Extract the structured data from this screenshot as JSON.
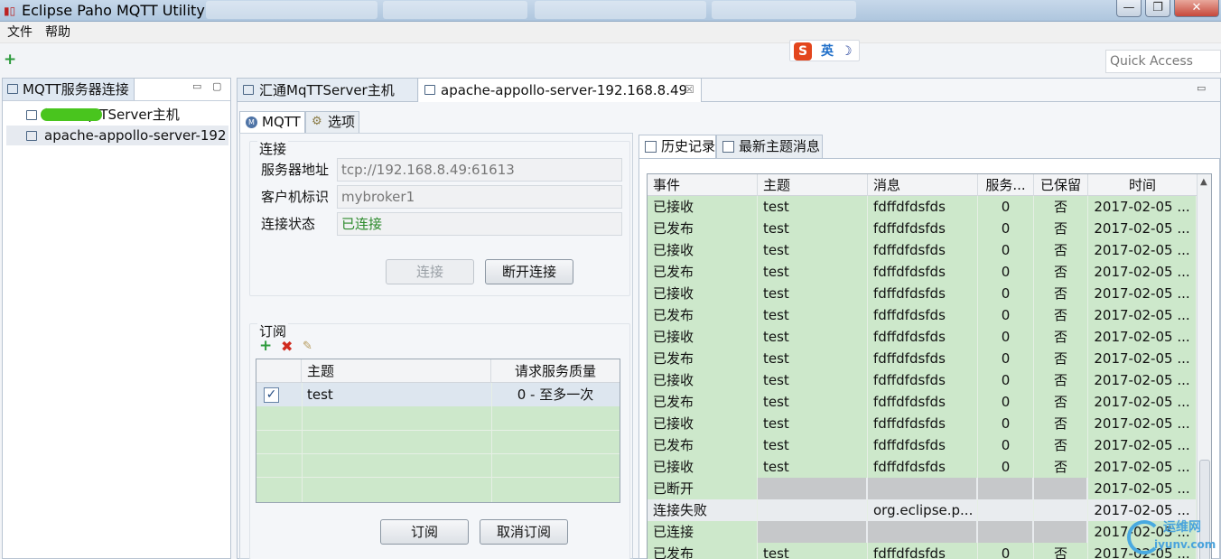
{
  "window": {
    "title": "Eclipse Paho MQTT Utility",
    "minimize": "—",
    "maximize": "❐",
    "close": "✕"
  },
  "menu": {
    "file": "文件",
    "help": "帮助"
  },
  "toolbar": {
    "add": "+",
    "quick_access_placeholder": "Quick Access"
  },
  "ime": {
    "logo": "S",
    "mode": "英",
    "moon": "☽"
  },
  "left_view": {
    "tab_label": "MQTT服务器连接",
    "minimize": "▭",
    "maximize": "▢",
    "nodes": [
      {
        "label": "汇通MqTTServer主机"
      },
      {
        "label": "apache-appollo-server-192"
      }
    ]
  },
  "editor": {
    "tabs": [
      {
        "label": "汇通MqTTServer主机"
      },
      {
        "label": "apache-appollo-server-192.168.8.49",
        "close": "☒"
      }
    ],
    "sub_tabs": {
      "mqtt": "MQTT",
      "options": "选项"
    }
  },
  "connection": {
    "title": "连接",
    "server_label": "服务器地址",
    "server_value": "tcp://192.168.8.49:61613",
    "client_label": "客户机标识",
    "client_value": "mybroker1",
    "status_label": "连接状态",
    "status_value": "已连接",
    "connect_button": "连接",
    "disconnect_button": "断开连接"
  },
  "subscription": {
    "title": "订阅",
    "add": "+",
    "delete": "✖",
    "clear": "✎",
    "columns": [
      "",
      "主题",
      "请求服务质量"
    ],
    "rows": [
      {
        "checked": "✓",
        "topic": "test",
        "qos": "0 - 至多一次"
      }
    ],
    "subscribe_button": "订阅",
    "unsubscribe_button": "取消订阅"
  },
  "history": {
    "tabs": {
      "history": "历史记录",
      "latest": "最新主题消息"
    },
    "columns": [
      "事件",
      "主题",
      "消息",
      "服务...",
      "已保留",
      "时间"
    ],
    "rows": [
      {
        "event": "已接收",
        "topic": "test",
        "message": "fdffdfdsfds",
        "qos": "0",
        "retained": "否",
        "time": "2017-02-05 ...",
        "style": "green"
      },
      {
        "event": "已发布",
        "topic": "test",
        "message": "fdffdfdsfds",
        "qos": "0",
        "retained": "否",
        "time": "2017-02-05 ...",
        "style": "green"
      },
      {
        "event": "已接收",
        "topic": "test",
        "message": "fdffdfdsfds",
        "qos": "0",
        "retained": "否",
        "time": "2017-02-05 ...",
        "style": "green"
      },
      {
        "event": "已发布",
        "topic": "test",
        "message": "fdffdfdsfds",
        "qos": "0",
        "retained": "否",
        "time": "2017-02-05 ...",
        "style": "green"
      },
      {
        "event": "已接收",
        "topic": "test",
        "message": "fdffdfdsfds",
        "qos": "0",
        "retained": "否",
        "time": "2017-02-05 ...",
        "style": "green"
      },
      {
        "event": "已发布",
        "topic": "test",
        "message": "fdffdfdsfds",
        "qos": "0",
        "retained": "否",
        "time": "2017-02-05 ...",
        "style": "green"
      },
      {
        "event": "已接收",
        "topic": "test",
        "message": "fdffdfdsfds",
        "qos": "0",
        "retained": "否",
        "time": "2017-02-05 ...",
        "style": "green"
      },
      {
        "event": "已发布",
        "topic": "test",
        "message": "fdffdfdsfds",
        "qos": "0",
        "retained": "否",
        "time": "2017-02-05 ...",
        "style": "green"
      },
      {
        "event": "已接收",
        "topic": "test",
        "message": "fdffdfdsfds",
        "qos": "0",
        "retained": "否",
        "time": "2017-02-05 ...",
        "style": "green"
      },
      {
        "event": "已发布",
        "topic": "test",
        "message": "fdffdfdsfds",
        "qos": "0",
        "retained": "否",
        "time": "2017-02-05 ...",
        "style": "green"
      },
      {
        "event": "已接收",
        "topic": "test",
        "message": "fdffdfdsfds",
        "qos": "0",
        "retained": "否",
        "time": "2017-02-05 ...",
        "style": "green"
      },
      {
        "event": "已发布",
        "topic": "test",
        "message": "fdffdfdsfds",
        "qos": "0",
        "retained": "否",
        "time": "2017-02-05 ...",
        "style": "green"
      },
      {
        "event": "已接收",
        "topic": "test",
        "message": "fdffdfdsfds",
        "qos": "0",
        "retained": "否",
        "time": "2017-02-05 ...",
        "style": "green"
      },
      {
        "event": "已断开",
        "topic": "",
        "message": "",
        "qos": "",
        "retained": "",
        "time": "2017-02-05 ...",
        "style": "green-empty"
      },
      {
        "event": "连接失败",
        "topic": "",
        "message": "org.eclipse.p...",
        "qos": "",
        "retained": "",
        "time": "2017-02-05 ...",
        "style": "grey"
      },
      {
        "event": "已连接",
        "topic": "",
        "message": "",
        "qos": "",
        "retained": "",
        "time": "2017-02-05 ...",
        "style": "green-empty"
      },
      {
        "event": "已发布",
        "topic": "test",
        "message": "fdffdfdsfds",
        "qos": "0",
        "retained": "否",
        "time": "2017-02-05 ...",
        "style": "green"
      }
    ]
  },
  "watermark": {
    "text": "运维网",
    "url": "iyunv.com"
  },
  "colors": {
    "row_green": "#cde8cb",
    "connected_green": "#2c8a2c",
    "add_green": "#2c9a3b",
    "delete_red": "#d02a1e"
  }
}
